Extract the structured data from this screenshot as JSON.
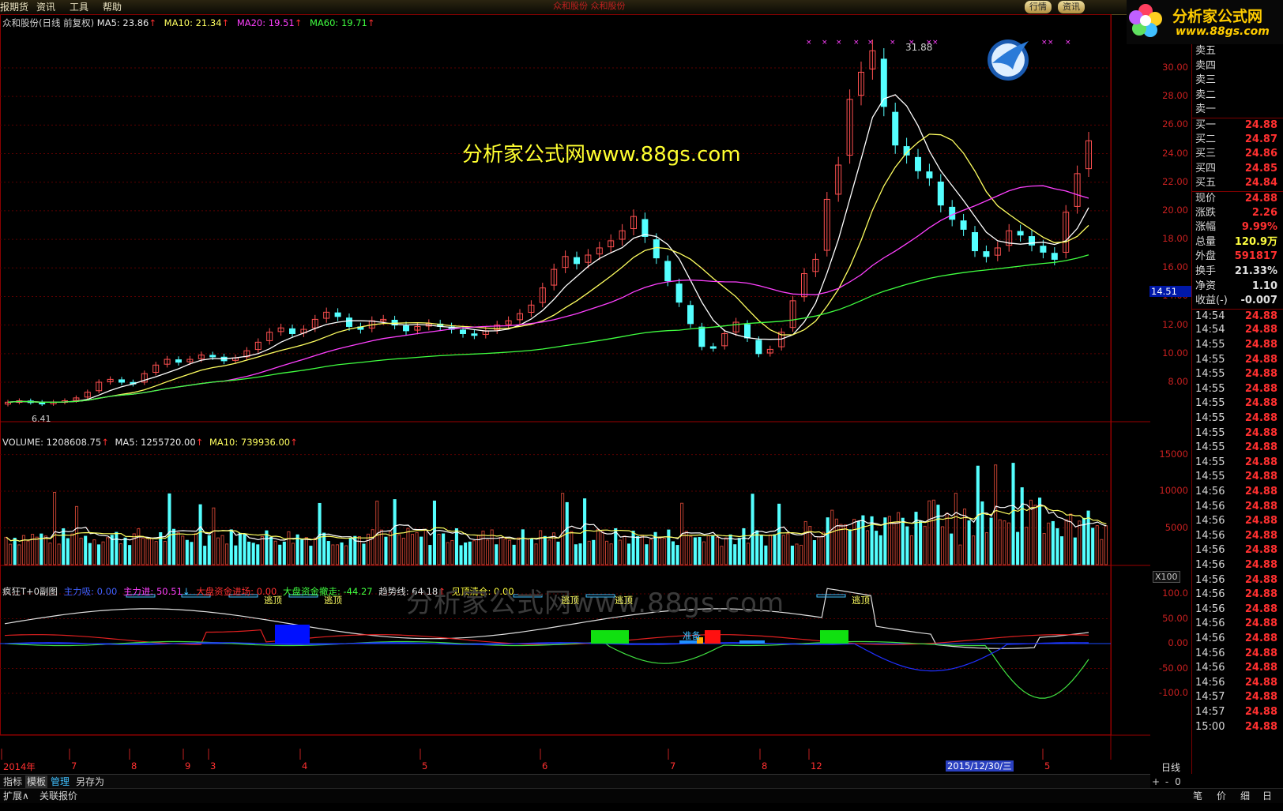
{
  "menu": [
    "报期货",
    "资讯",
    "工具",
    "帮助"
  ],
  "title_center": "众和股份 众和股份",
  "top_tabs": [
    "行情",
    "资讯"
  ],
  "logo": {
    "text": "分析家公式网",
    "url": "www.88gs.com"
  },
  "main_legend": {
    "name": "众和股份(日线 前复权)",
    "ma5": "MA5: 23.86",
    "ma10": "MA10: 21.34",
    "ma20": "MA20: 19.51",
    "ma60": "MA60: 19.71"
  },
  "watermark_top": "分析家公式网www.88gs.com",
  "watermark_bottom": "分析家公式网www.88gs.com",
  "price_high_label": "31.88",
  "price_low_label": "6.41",
  "price_axis": [
    "30.00",
    "28.00",
    "26.00",
    "24.00",
    "22.00",
    "20.00",
    "18.00",
    "16.00",
    "14.00",
    "12.00",
    "10.00",
    "8.00"
  ],
  "current_price_tag": "14.51",
  "volume_legend": {
    "volume": "VOLUME: 1208608.75",
    "ma5": "MA5: 1255720.00",
    "ma10": "MA10: 739936.00"
  },
  "volume_axis": [
    "15000",
    "10000",
    "5000"
  ],
  "volume_unit": "X100",
  "indicator_legend": {
    "name": "疯狂T+0副图",
    "zhulixi": "主力吸: 0.00",
    "zhulijin": "主力进: 50.51",
    "dapan_in": "大盘资金进场: 0.00",
    "dapan_out": "大盘资金撤走: -44.27",
    "trend": "趋势线: 64.18",
    "top_clear": "见顶清仓: 0.00"
  },
  "indicator_axis": [
    "100.0",
    "50.00",
    "0.00",
    "-50.00",
    "-100.0"
  ],
  "indicator_labels": {
    "escape": "逃顶",
    "prepare": "准备"
  },
  "date_axis": [
    "2014年",
    "7",
    "8",
    "9",
    "3",
    "4",
    "5",
    "6",
    "7",
    "8",
    "12",
    "5"
  ],
  "date_highlight": "2015/12/30/三",
  "period_label": "日线",
  "bottom_tabs": [
    "指标",
    "模板",
    "管理",
    "另存为"
  ],
  "bottom_tabs2": [
    "扩展∧",
    "关联报价"
  ],
  "nav_buttons": [
    "+",
    "-",
    "0"
  ],
  "right_bottom_tabs": [
    "笔",
    "价",
    "细",
    "日"
  ],
  "quote_panel": {
    "sell": [
      {
        "k": "卖五",
        "v": ""
      },
      {
        "k": "卖四",
        "v": ""
      },
      {
        "k": "卖三",
        "v": ""
      },
      {
        "k": "卖二",
        "v": ""
      },
      {
        "k": "卖一",
        "v": ""
      }
    ],
    "buy": [
      {
        "k": "买一",
        "v": "24.88"
      },
      {
        "k": "买二",
        "v": "24.87"
      },
      {
        "k": "买三",
        "v": "24.86"
      },
      {
        "k": "买四",
        "v": "24.85"
      },
      {
        "k": "买五",
        "v": "24.84"
      }
    ],
    "stats": [
      {
        "k": "现价",
        "v": "24.88",
        "color": "#ff3030"
      },
      {
        "k": "涨跌",
        "v": "2.26",
        "color": "#ff3030"
      },
      {
        "k": "涨幅",
        "v": "9.99%",
        "color": "#ff3030"
      },
      {
        "k": "总量",
        "v": "120.9万",
        "color": "#ffff40"
      },
      {
        "k": "外盘",
        "v": "591817",
        "color": "#ff3030"
      },
      {
        "k": "换手",
        "v": "21.33%",
        "color": "#e0e0e0"
      },
      {
        "k": "净资",
        "v": "1.10",
        "color": "#e0e0e0"
      },
      {
        "k": "收益(-)",
        "v": "-0.007",
        "color": "#e0e0e0"
      }
    ],
    "ticks": [
      {
        "t": "14:54",
        "p": "24.88"
      },
      {
        "t": "14:54",
        "p": "24.88"
      },
      {
        "t": "14:55",
        "p": "24.88"
      },
      {
        "t": "14:55",
        "p": "24.88"
      },
      {
        "t": "14:55",
        "p": "24.88"
      },
      {
        "t": "14:55",
        "p": "24.88"
      },
      {
        "t": "14:55",
        "p": "24.88"
      },
      {
        "t": "14:55",
        "p": "24.88"
      },
      {
        "t": "14:55",
        "p": "24.88"
      },
      {
        "t": "14:55",
        "p": "24.88"
      },
      {
        "t": "14:55",
        "p": "24.88"
      },
      {
        "t": "14:55",
        "p": "24.88"
      },
      {
        "t": "14:56",
        "p": "24.88"
      },
      {
        "t": "14:56",
        "p": "24.88"
      },
      {
        "t": "14:56",
        "p": "24.88"
      },
      {
        "t": "14:56",
        "p": "24.88"
      },
      {
        "t": "14:56",
        "p": "24.88"
      },
      {
        "t": "14:56",
        "p": "24.88"
      },
      {
        "t": "14:56",
        "p": "24.88"
      },
      {
        "t": "14:56",
        "p": "24.88"
      },
      {
        "t": "14:56",
        "p": "24.88"
      },
      {
        "t": "14:56",
        "p": "24.88"
      },
      {
        "t": "14:56",
        "p": "24.88"
      },
      {
        "t": "14:56",
        "p": "24.88"
      },
      {
        "t": "14:56",
        "p": "24.88"
      },
      {
        "t": "14:56",
        "p": "24.88"
      },
      {
        "t": "14:57",
        "p": "24.88"
      },
      {
        "t": "14:57",
        "p": "24.88"
      },
      {
        "t": "15:00",
        "p": "24.88"
      }
    ]
  },
  "colors": {
    "up": "#ff5050",
    "down": "#54ffff",
    "ma5": "#ffffff",
    "ma10": "#ffff60",
    "ma20": "#ff40ff",
    "ma60": "#40ff40",
    "grid": "#5a0000"
  },
  "chart_data": {
    "type": "line",
    "title": "众和股份(日线 前复权)",
    "close": [
      6.6,
      6.7,
      6.6,
      6.5,
      6.6,
      6.7,
      6.9,
      7.3,
      8.0,
      8.2,
      8.0,
      7.9,
      8.6,
      9.2,
      9.6,
      9.4,
      9.6,
      9.9,
      9.8,
      9.5,
      9.7,
      10.2,
      10.8,
      11.5,
      11.8,
      11.4,
      11.7,
      12.4,
      12.9,
      12.6,
      11.9,
      11.7,
      12.3,
      12.4,
      12.0,
      11.6,
      11.9,
      12.1,
      11.9,
      11.7,
      11.4,
      11.3,
      11.6,
      12.0,
      12.3,
      12.8,
      13.4,
      14.6,
      15.9,
      16.8,
      16.3,
      16.9,
      17.4,
      17.9,
      18.6,
      19.6,
      18.2,
      16.7,
      15.1,
      13.6,
      12.1,
      10.5,
      10.4,
      11.4,
      12.2,
      11.1,
      10.0,
      10.3,
      11.5,
      13.7,
      15.6,
      16.6,
      20.8,
      23.2,
      27.8,
      29.7,
      31.2,
      27.3,
      24.6,
      23.9,
      22.8,
      22.3,
      20.4,
      19.4,
      18.7,
      17.2,
      16.8,
      17.4,
      18.6,
      18.3,
      17.6,
      17.1,
      16.6,
      19.9,
      22.6,
      24.9
    ]
  }
}
